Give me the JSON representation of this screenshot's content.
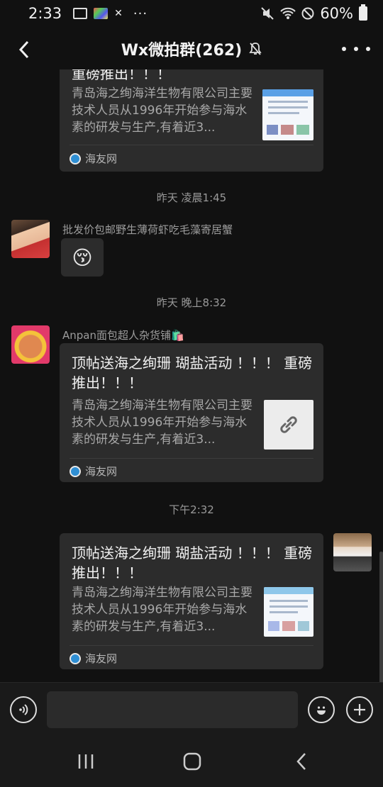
{
  "status": {
    "time": "2:33",
    "dots": "···",
    "battery": "60%"
  },
  "header": {
    "title": "Wx微拍群(262)"
  },
  "messages": [
    {
      "title_line2": "重磅推出！！！",
      "desc": "青岛海之绚海洋生物有限公司主要技术人员从1996年开始参与海水素的研发与生产,有着近3...",
      "source": "海友网"
    },
    {
      "timestamp": "昨天 凌晨1:45"
    },
    {
      "sender": "批发价包邮野生薄荷虾吃毛藻寄居蟹",
      "emoji": "😚"
    },
    {
      "timestamp": "昨天 晚上8:32"
    },
    {
      "sender": "Anpan面包超人杂货铺🛍️",
      "title": "顶帖送海之绚珊 瑚盐活动 ！！！ 重磅推出！！！",
      "desc": "青岛海之绚海洋生物有限公司主要技术人员从1996年开始参与海水素的研发与生产,有着近3...",
      "source": "海友网"
    },
    {
      "timestamp": "下午2:32"
    },
    {
      "title": "顶帖送海之绚珊 瑚盐活动 ！！！ 重磅推出！！！",
      "desc": "青岛海之绚海洋生物有限公司主要技术人员从1996年开始参与海水素的研发与生产,有着近3...",
      "source": "海友网"
    }
  ],
  "input": {
    "placeholder": ""
  },
  "colors": {
    "background": "#111111",
    "bubble": "#2c2c2c",
    "accent": "#2f8fd4"
  },
  "icons": [
    "back-arrow-icon",
    "mute-bell-icon",
    "more-dots-icon",
    "voice-icon",
    "emoji-icon",
    "plus-icon",
    "link-icon",
    "recent-apps-icon",
    "home-icon",
    "nav-back-icon"
  ]
}
